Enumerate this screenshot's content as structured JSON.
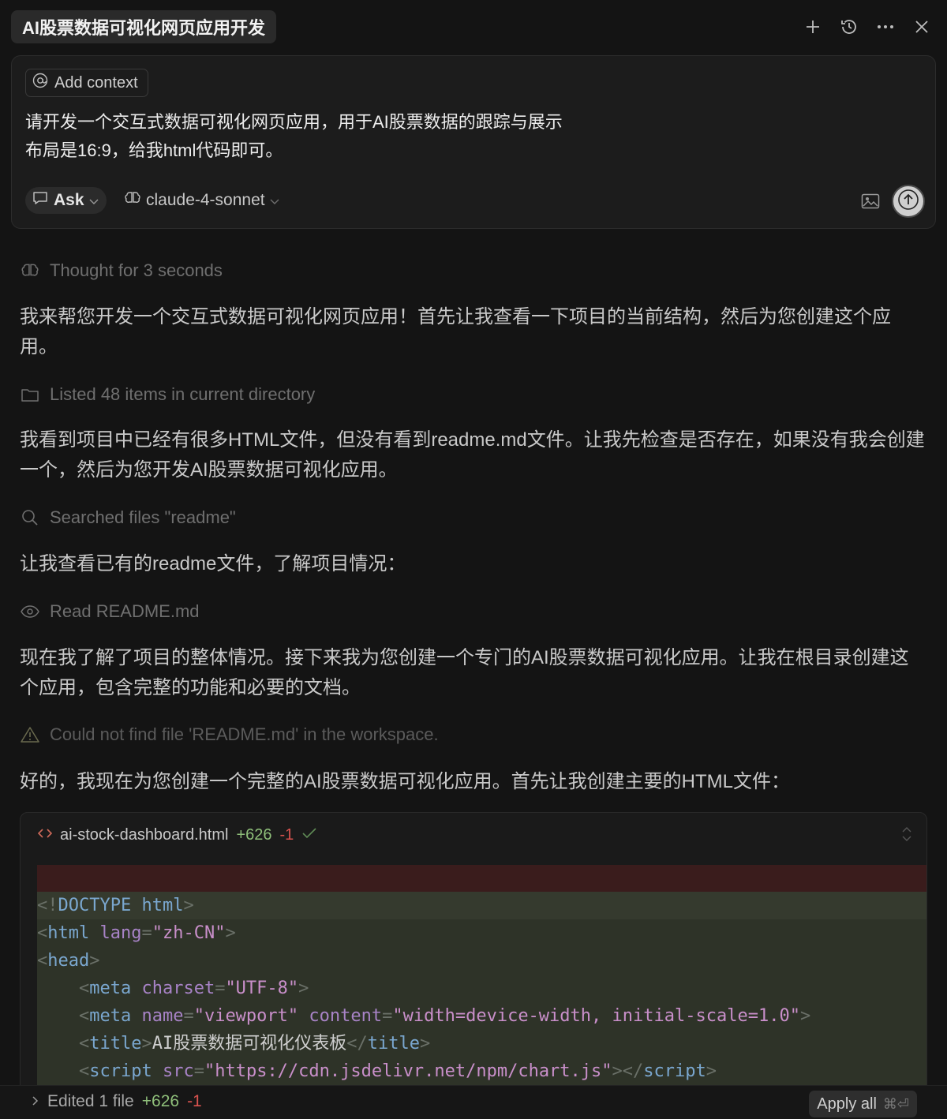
{
  "header": {
    "title": "AI股票数据可视化网页应用开发",
    "icons": [
      "plus-icon",
      "history-icon",
      "more-icon",
      "close-icon"
    ]
  },
  "composer": {
    "add_context_label": "Add context",
    "prompt_lines": [
      "请开发一个交互式数据可视化网页应用，用于AI股票数据的跟踪与展示",
      "布局是16:9，给我html代码即可。"
    ],
    "mode_label": "Ask",
    "model_label": "claude-4-sonnet"
  },
  "conversation": {
    "thought": "Thought for 3 seconds",
    "msg1": "我来帮您开发一个交互式数据可视化网页应用！首先让我查看一下项目的当前结构，然后为您创建这个应用。",
    "listed": "Listed 48 items in current directory",
    "msg2": "我看到项目中已经有很多HTML文件，但没有看到readme.md文件。让我先检查是否存在，如果没有我会创建一个，然后为您开发AI股票数据可视化应用。",
    "searched": "Searched files \"readme\"",
    "msg3": "让我查看已有的readme文件，了解项目情况：",
    "read": "Read README.md",
    "msg4": "现在我了解了项目的整体情况。接下来我为您创建一个专门的AI股票数据可视化应用。让我在根目录创建这个应用，包含完整的功能和必要的文档。",
    "warning": "Could not find file 'README.md' in the workspace.",
    "msg5": "好的，我现在为您创建一个完整的AI股票数据可视化应用。首先让我创建主要的HTML文件："
  },
  "code_block": {
    "filename": "ai-stock-dashboard.html",
    "additions": "+626",
    "deletions": "-1",
    "lines": [
      [
        [
          "punc",
          "<!"
        ],
        [
          "tag",
          "DOCTYPE html"
        ],
        [
          "punc",
          ">"
        ]
      ],
      [
        [
          "punc",
          "<"
        ],
        [
          "tag",
          "html"
        ],
        [
          "text",
          " "
        ],
        [
          "attr",
          "lang"
        ],
        [
          "punc",
          "="
        ],
        [
          "str",
          "\"zh-CN\""
        ],
        [
          "punc",
          ">"
        ]
      ],
      [
        [
          "punc",
          "<"
        ],
        [
          "tag",
          "head"
        ],
        [
          "punc",
          ">"
        ]
      ],
      [
        [
          "text",
          "    "
        ],
        [
          "punc",
          "<"
        ],
        [
          "tag",
          "meta"
        ],
        [
          "text",
          " "
        ],
        [
          "attr",
          "charset"
        ],
        [
          "punc",
          "="
        ],
        [
          "str",
          "\"UTF-8\""
        ],
        [
          "punc",
          ">"
        ]
      ],
      [
        [
          "text",
          "    "
        ],
        [
          "punc",
          "<"
        ],
        [
          "tag",
          "meta"
        ],
        [
          "text",
          " "
        ],
        [
          "attr",
          "name"
        ],
        [
          "punc",
          "="
        ],
        [
          "str",
          "\"viewport\""
        ],
        [
          "text",
          " "
        ],
        [
          "attr",
          "content"
        ],
        [
          "punc",
          "="
        ],
        [
          "str",
          "\"width=device-width, initial-scale=1.0\""
        ],
        [
          "punc",
          ">"
        ]
      ],
      [
        [
          "text",
          "    "
        ],
        [
          "punc",
          "<"
        ],
        [
          "tag",
          "title"
        ],
        [
          "punc",
          ">"
        ],
        [
          "text",
          "AI股票数据可视化仪表板"
        ],
        [
          "punc",
          "</"
        ],
        [
          "tag",
          "title"
        ],
        [
          "punc",
          ">"
        ]
      ],
      [
        [
          "text",
          "    "
        ],
        [
          "punc",
          "<"
        ],
        [
          "tag",
          "script"
        ],
        [
          "text",
          " "
        ],
        [
          "attr",
          "src"
        ],
        [
          "punc",
          "="
        ],
        [
          "str",
          "\"https://cdn.jsdelivr.net/npm/chart.js\""
        ],
        [
          "punc",
          "></"
        ],
        [
          "tag",
          "script"
        ],
        [
          "punc",
          ">"
        ]
      ]
    ]
  },
  "bottom_bar": {
    "edited_label": "Edited 1 file",
    "additions": "+626",
    "deletions": "-1",
    "apply_label": "Apply all",
    "shortcut": "⌘⏎"
  }
}
